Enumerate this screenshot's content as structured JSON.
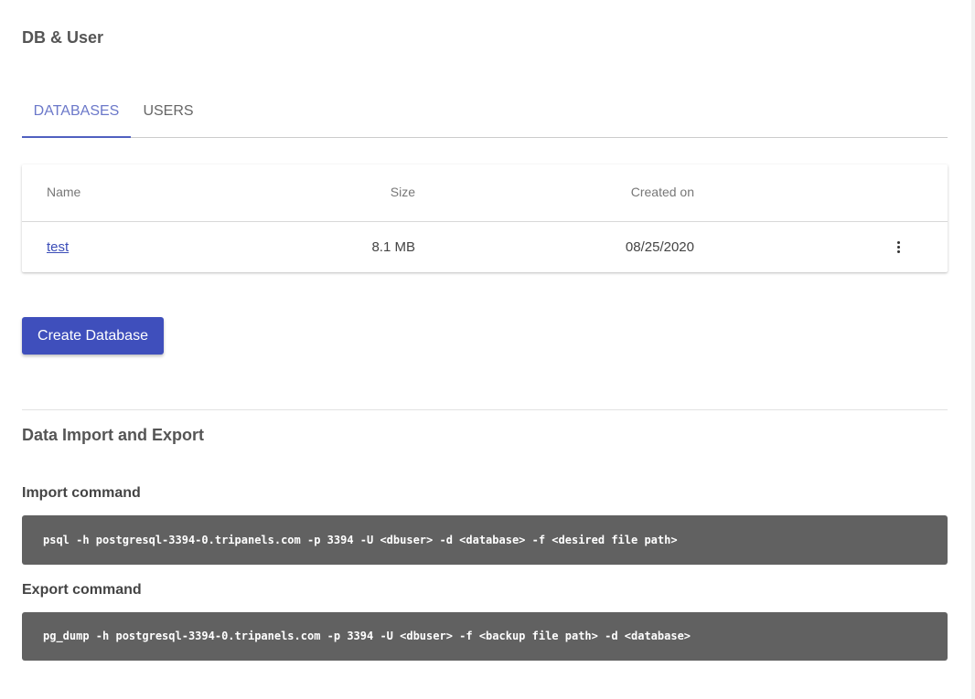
{
  "page": {
    "title": "DB & User"
  },
  "tabs": [
    {
      "label": "DATABASES",
      "active": true
    },
    {
      "label": "USERS",
      "active": false
    }
  ],
  "table": {
    "columns": {
      "name": "Name",
      "size": "Size",
      "created": "Created on"
    },
    "rows": [
      {
        "name": "test",
        "size": "8.1 MB",
        "created": "08/25/2020",
        "menu_icon": "more-vert-icon"
      }
    ]
  },
  "actions": {
    "create_label": "Create Database"
  },
  "import_export": {
    "title": "Data Import and Export",
    "import_label": "Import command",
    "import_command": "psql -h postgresql-3394-0.tripanels.com -p 3394 -U <dbuser> -d <database> -f <desired file path>",
    "export_label": "Export command",
    "export_command": "pg_dump -h postgresql-3394-0.tripanels.com -p 3394 -U <dbuser> -f <backup file path> -d <database>"
  },
  "colors": {
    "accent": "#3f4fbc",
    "active_tab": "#6b78c9",
    "link": "#3b4db8",
    "code_bg": "#616161"
  }
}
